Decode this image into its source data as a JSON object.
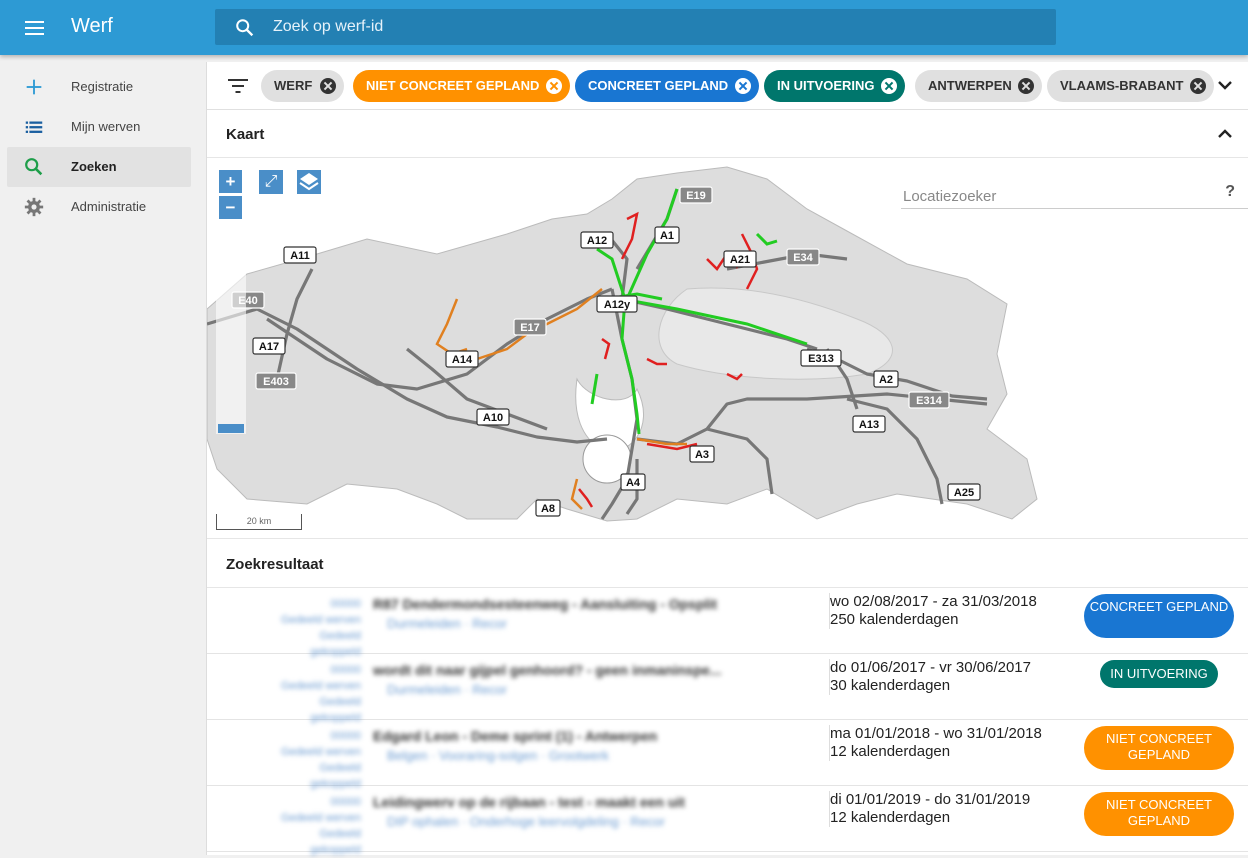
{
  "app": {
    "title": "Werf"
  },
  "search": {
    "placeholder": "Zoek op werf-id"
  },
  "sidebar": {
    "items": [
      {
        "label": "Registratie",
        "icon": "plus-icon"
      },
      {
        "label": "Mijn werven",
        "icon": "list-icon"
      },
      {
        "label": "Zoeken",
        "icon": "search-icon",
        "active": true
      },
      {
        "label": "Administratie",
        "icon": "gear-icon"
      }
    ]
  },
  "filters": {
    "chips": [
      {
        "label": "WERF",
        "color": "#e0e0e0"
      },
      {
        "label": "NIET CONCREET GEPLAND",
        "color": "#ff9100"
      },
      {
        "label": "CONCREET GEPLAND",
        "color": "#1976d2"
      },
      {
        "label": "IN UITVOERING",
        "color": "#00766c"
      },
      {
        "label": "ANTWERPEN",
        "color": "#e0e0e0"
      },
      {
        "label": "VLAAMS-BRABANT",
        "color": "#e0e0e0"
      }
    ]
  },
  "map_section": {
    "title": "Kaart",
    "zoom_in": "+",
    "zoom_out": "−",
    "fullscreen": "⤢",
    "locator_placeholder": "Locatiezoeker",
    "locator_help": "?",
    "scale": "20 km",
    "road_labels": [
      "A11",
      "E40",
      "A17",
      "E403",
      "A12",
      "A1",
      "E19",
      "A21",
      "E34",
      "A12y",
      "E17",
      "A14",
      "A10",
      "E313",
      "A2",
      "E314",
      "A13",
      "A3",
      "A4",
      "A8",
      "A25"
    ],
    "colors": {
      "in_uitvoering": "#22cc22",
      "niet_concreet": "#e02020",
      "concreet": "#e08020"
    }
  },
  "results_section": {
    "title": "Zoekresultaat",
    "rows": [
      {
        "meta": [
          "00000",
          "Gedeeld werven",
          "Gedeeld",
          "gekoppeld"
        ],
        "title": "R87 Dendermondsesteenweg - Aansluiting - Opsplit",
        "sub": "Durmeleiden · Recor",
        "dates": "wo 02/08/2017 - za 31/03/2018",
        "days": "250 kalenderdagen",
        "status": "CONCREET GEPLAND",
        "status_color": "#1976d2"
      },
      {
        "meta": [
          "00000",
          "Gedeeld werven",
          "Gedeeld",
          "gekoppeld"
        ],
        "title": "wordt dit naar gijpel genhoord? - geen inmaninspe...",
        "sub": "Durmeleiden · Recor",
        "dates": "do 01/06/2017 - vr 30/06/2017",
        "days": "30 kalenderdagen",
        "status": "IN UITVOERING",
        "status_color": "#00766c"
      },
      {
        "meta": [
          "00000",
          "Gedeeld werven",
          "Gedeeld",
          "gekoppeld"
        ],
        "title": "Edgard Leon - Deme sprint (1) - Antwerpen",
        "sub": "Belgen · Vooraring-solgen · Grootwerk",
        "dates": "ma 01/01/2018 - wo 31/01/2018",
        "days": "12 kalenderdagen",
        "status": "NIET CONCREET GEPLAND",
        "status_color": "#ff9100"
      },
      {
        "meta": [
          "00000",
          "Gedeeld werven",
          "Gedeeld",
          "gekoppeld"
        ],
        "title": "Leidingwerv op de rijbaan - test - maakt een uit",
        "sub": "DIP ophalen · Onderhoge leervolgdeling · Recor",
        "dates": "di 01/01/2019 - do 31/01/2019",
        "days": "12 kalenderdagen",
        "status": "NIET CONCREET GEPLAND",
        "status_color": "#ff9100"
      }
    ]
  }
}
